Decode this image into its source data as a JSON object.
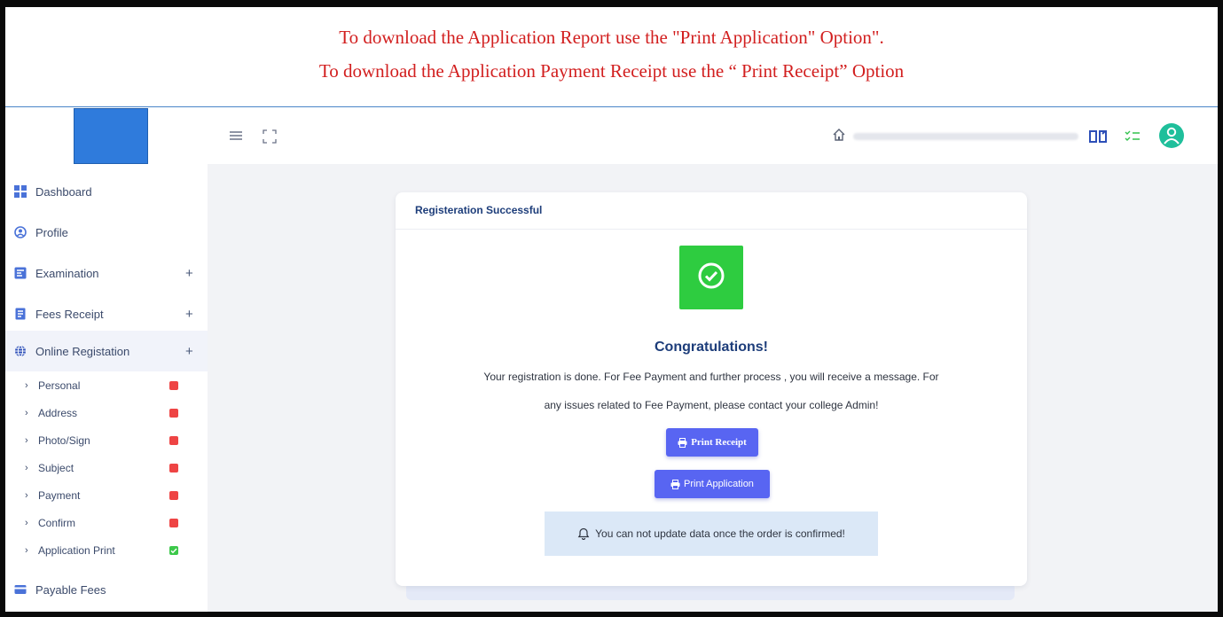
{
  "banner": {
    "line1": "To download the Application Report use the \"Print Application\" Option\".",
    "line2": "To download the Application Payment Receipt use the “ Print Receipt” Option"
  },
  "sidebar": {
    "items": [
      {
        "label": "Dashboard",
        "icon": "dashboard-icon"
      },
      {
        "label": "Profile",
        "icon": "profile-icon"
      },
      {
        "label": "Examination",
        "icon": "examination-icon",
        "expand": "+"
      },
      {
        "label": "Fees Receipt",
        "icon": "receipt-icon",
        "expand": "+"
      },
      {
        "label": "Online Registation",
        "icon": "globe-icon",
        "expand": "+"
      }
    ],
    "subitems": [
      {
        "label": "Personal",
        "status": "incomplete"
      },
      {
        "label": "Address",
        "status": "incomplete"
      },
      {
        "label": "Photo/Sign",
        "status": "incomplete"
      },
      {
        "label": "Subject",
        "status": "incomplete"
      },
      {
        "label": "Payment",
        "status": "incomplete"
      },
      {
        "label": "Confirm",
        "status": "incomplete"
      },
      {
        "label": "Application Print",
        "status": "complete"
      }
    ],
    "bottom_item": {
      "label": "Payable Fees",
      "icon": "card-icon"
    }
  },
  "card": {
    "title": "Registeration Successful",
    "congrats": "Congratulations!",
    "message_line1": "Your registration is done. For Fee Payment and further process , you will receive a message. For",
    "message_line2": "any issues related to Fee Payment, please contact your college Admin!",
    "print_receipt_label": "Print Receipt",
    "print_application_label": "Print Application",
    "notice": "You can not update data once the order is confirmed!"
  },
  "colors": {
    "banner_text": "#d21f1f",
    "primary": "#5865f2",
    "success": "#2ecc40",
    "incomplete": "#ee4444",
    "complete": "#3cc84a",
    "title": "#1d3d7a"
  }
}
